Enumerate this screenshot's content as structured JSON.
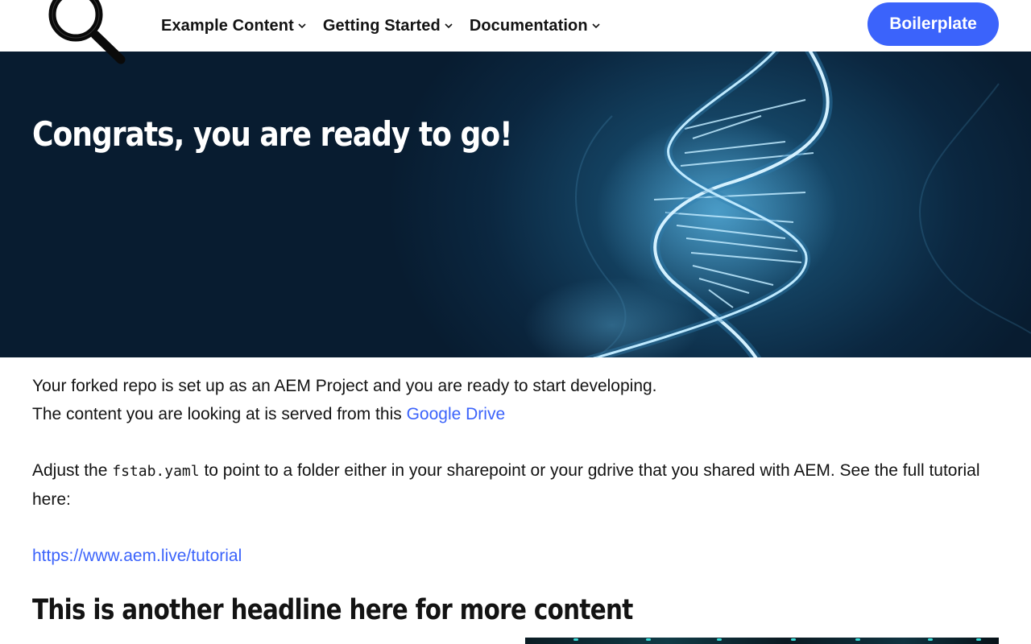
{
  "header": {
    "nav": [
      {
        "label": "Example Content"
      },
      {
        "label": "Getting Started"
      },
      {
        "label": "Documentation"
      }
    ],
    "cta_label": "Boilerplate"
  },
  "hero": {
    "title": "Congrats, you are ready to go!"
  },
  "content": {
    "p1_line1": "Your forked repo is set up as an AEM Project and you are ready to start developing.",
    "p1_line2_prefix": "The content you are looking at is served from this ",
    "p1_link": "Google Drive",
    "p2_prefix": "Adjust the ",
    "p2_code": "fstab.yaml",
    "p2_suffix": " to point to a folder either in your sharepoint or your gdrive that you shared with AEM. See the full tutorial here:",
    "tutorial_link": "https://www.aem.live/tutorial",
    "headline2": "This is another headline here for more content"
  },
  "colors": {
    "accent": "#3b63fb",
    "text": "#131313",
    "hero_bg": "#0b2740"
  },
  "icons": {
    "logo": "magnifier-icon",
    "nav_dropdown": "chevron-down-icon"
  }
}
